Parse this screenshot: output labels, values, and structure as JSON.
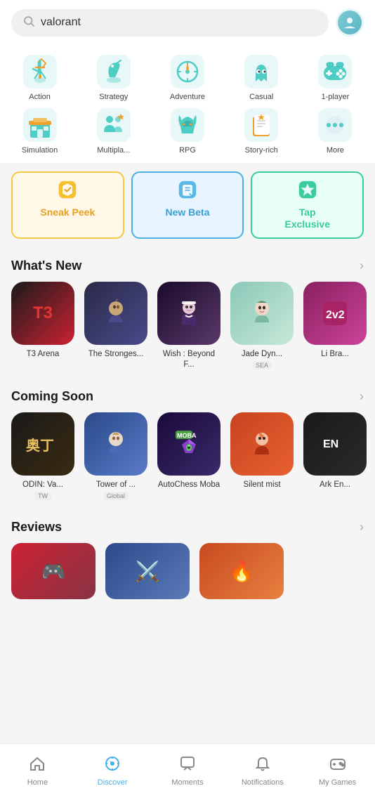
{
  "search": {
    "placeholder": "valorant",
    "value": "valorant"
  },
  "categories": [
    {
      "id": "action",
      "label": "Action",
      "icon": "action",
      "color": "#4ecdc4"
    },
    {
      "id": "strategy",
      "label": "Strategy",
      "icon": "strategy",
      "color": "#4ecdc4"
    },
    {
      "id": "adventure",
      "label": "Adventure",
      "icon": "adventure",
      "color": "#4ecdc4"
    },
    {
      "id": "casual",
      "label": "Casual",
      "icon": "casual",
      "color": "#4ecdc4"
    },
    {
      "id": "1player",
      "label": "1-player",
      "icon": "1player",
      "color": "#4ecdc4"
    },
    {
      "id": "simulation",
      "label": "Simulation",
      "icon": "simulation",
      "color": "#4ecdc4"
    },
    {
      "id": "multiplayer",
      "label": "Multipla...",
      "icon": "multiplayer",
      "color": "#4ecdc4"
    },
    {
      "id": "rpg",
      "label": "RPG",
      "icon": "rpg",
      "color": "#4ecdc4"
    },
    {
      "id": "storyrich",
      "label": "Story-rich",
      "icon": "storyrich",
      "color": "#4ecdc4"
    },
    {
      "id": "more",
      "label": "More",
      "icon": "more",
      "color": "#4ecdc4"
    }
  ],
  "tabs": [
    {
      "id": "sneak-peek",
      "label": "Sneak Peek",
      "icon": "✅",
      "style": "sneak"
    },
    {
      "id": "new-beta",
      "label": "New Beta",
      "icon": "📝",
      "style": "new-beta"
    },
    {
      "id": "tap-exclusive",
      "label": "Tap\nExclusive",
      "icon": "⚡",
      "style": "tap-exclusive"
    }
  ],
  "whats_new": {
    "title": "What's New",
    "games": [
      {
        "id": "t3arena",
        "name": "T3 Arena",
        "bg": "#cc1a2a",
        "text_icon": "T3",
        "text_color": "#e63333"
      },
      {
        "id": "strongest",
        "name": "The Stronges...",
        "bg": "#2a2a4a",
        "emoji": "🗡️"
      },
      {
        "id": "wishbeyond",
        "name": "Wish : Beyond F...",
        "bg": "#3a2a4a",
        "emoji": "🎀"
      },
      {
        "id": "jadedyn",
        "name": "Jade Dyn...",
        "tag": "SEA",
        "bg": "#c8e8d8",
        "emoji": "👧"
      },
      {
        "id": "li",
        "name": "Li Bra...",
        "bg": "#cc4488",
        "emoji": "🎮"
      }
    ]
  },
  "coming_soon": {
    "title": "Coming Soon",
    "games": [
      {
        "id": "odin",
        "name": "ODIN: Va...",
        "tag": "TW",
        "bg": "#1a1a1a",
        "emoji": "奥丁"
      },
      {
        "id": "tower",
        "name": "Tower of ...",
        "tag": "Global",
        "bg": "#3a6ab8",
        "emoji": "🧝"
      },
      {
        "id": "autochess",
        "name": "AutoChess Moba",
        "bg": "#2a1a4a",
        "emoji": "♟️"
      },
      {
        "id": "silentmist",
        "name": "Silent mist",
        "bg": "#cc4422",
        "emoji": "🔥"
      },
      {
        "id": "ark",
        "name": "Ark En...",
        "bg": "#1a1a1a",
        "emoji": "🎮"
      }
    ]
  },
  "reviews": {
    "title": "Reviews"
  },
  "bottom_nav": [
    {
      "id": "home",
      "icon": "🏠",
      "label": "Home",
      "active": false
    },
    {
      "id": "discover",
      "icon": "🔮",
      "label": "Discover",
      "active": true
    },
    {
      "id": "moments",
      "icon": "💬",
      "label": "Moments",
      "active": false
    },
    {
      "id": "notifications",
      "icon": "🔔",
      "label": "Notifications",
      "active": false
    },
    {
      "id": "my-games",
      "icon": "🎮",
      "label": "My Games",
      "active": false
    }
  ],
  "colors": {
    "accent": "#4ab0e8",
    "active_nav": "#4ab0e8"
  }
}
